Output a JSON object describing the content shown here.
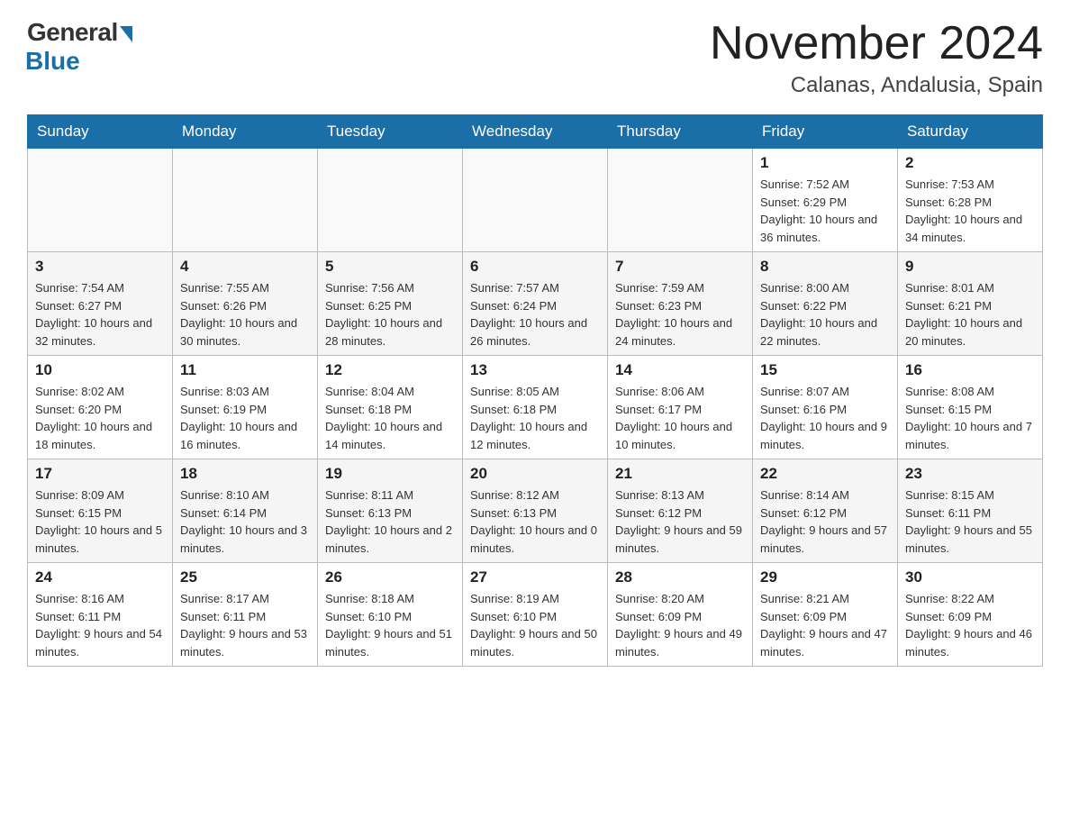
{
  "header": {
    "logo_general": "General",
    "logo_blue": "Blue",
    "month_title": "November 2024",
    "location": "Calanas, Andalusia, Spain"
  },
  "days_of_week": [
    "Sunday",
    "Monday",
    "Tuesday",
    "Wednesday",
    "Thursday",
    "Friday",
    "Saturday"
  ],
  "weeks": [
    [
      {
        "day": "",
        "sunrise": "",
        "sunset": "",
        "daylight": ""
      },
      {
        "day": "",
        "sunrise": "",
        "sunset": "",
        "daylight": ""
      },
      {
        "day": "",
        "sunrise": "",
        "sunset": "",
        "daylight": ""
      },
      {
        "day": "",
        "sunrise": "",
        "sunset": "",
        "daylight": ""
      },
      {
        "day": "",
        "sunrise": "",
        "sunset": "",
        "daylight": ""
      },
      {
        "day": "1",
        "sunrise": "Sunrise: 7:52 AM",
        "sunset": "Sunset: 6:29 PM",
        "daylight": "Daylight: 10 hours and 36 minutes."
      },
      {
        "day": "2",
        "sunrise": "Sunrise: 7:53 AM",
        "sunset": "Sunset: 6:28 PM",
        "daylight": "Daylight: 10 hours and 34 minutes."
      }
    ],
    [
      {
        "day": "3",
        "sunrise": "Sunrise: 7:54 AM",
        "sunset": "Sunset: 6:27 PM",
        "daylight": "Daylight: 10 hours and 32 minutes."
      },
      {
        "day": "4",
        "sunrise": "Sunrise: 7:55 AM",
        "sunset": "Sunset: 6:26 PM",
        "daylight": "Daylight: 10 hours and 30 minutes."
      },
      {
        "day": "5",
        "sunrise": "Sunrise: 7:56 AM",
        "sunset": "Sunset: 6:25 PM",
        "daylight": "Daylight: 10 hours and 28 minutes."
      },
      {
        "day": "6",
        "sunrise": "Sunrise: 7:57 AM",
        "sunset": "Sunset: 6:24 PM",
        "daylight": "Daylight: 10 hours and 26 minutes."
      },
      {
        "day": "7",
        "sunrise": "Sunrise: 7:59 AM",
        "sunset": "Sunset: 6:23 PM",
        "daylight": "Daylight: 10 hours and 24 minutes."
      },
      {
        "day": "8",
        "sunrise": "Sunrise: 8:00 AM",
        "sunset": "Sunset: 6:22 PM",
        "daylight": "Daylight: 10 hours and 22 minutes."
      },
      {
        "day": "9",
        "sunrise": "Sunrise: 8:01 AM",
        "sunset": "Sunset: 6:21 PM",
        "daylight": "Daylight: 10 hours and 20 minutes."
      }
    ],
    [
      {
        "day": "10",
        "sunrise": "Sunrise: 8:02 AM",
        "sunset": "Sunset: 6:20 PM",
        "daylight": "Daylight: 10 hours and 18 minutes."
      },
      {
        "day": "11",
        "sunrise": "Sunrise: 8:03 AM",
        "sunset": "Sunset: 6:19 PM",
        "daylight": "Daylight: 10 hours and 16 minutes."
      },
      {
        "day": "12",
        "sunrise": "Sunrise: 8:04 AM",
        "sunset": "Sunset: 6:18 PM",
        "daylight": "Daylight: 10 hours and 14 minutes."
      },
      {
        "day": "13",
        "sunrise": "Sunrise: 8:05 AM",
        "sunset": "Sunset: 6:18 PM",
        "daylight": "Daylight: 10 hours and 12 minutes."
      },
      {
        "day": "14",
        "sunrise": "Sunrise: 8:06 AM",
        "sunset": "Sunset: 6:17 PM",
        "daylight": "Daylight: 10 hours and 10 minutes."
      },
      {
        "day": "15",
        "sunrise": "Sunrise: 8:07 AM",
        "sunset": "Sunset: 6:16 PM",
        "daylight": "Daylight: 10 hours and 9 minutes."
      },
      {
        "day": "16",
        "sunrise": "Sunrise: 8:08 AM",
        "sunset": "Sunset: 6:15 PM",
        "daylight": "Daylight: 10 hours and 7 minutes."
      }
    ],
    [
      {
        "day": "17",
        "sunrise": "Sunrise: 8:09 AM",
        "sunset": "Sunset: 6:15 PM",
        "daylight": "Daylight: 10 hours and 5 minutes."
      },
      {
        "day": "18",
        "sunrise": "Sunrise: 8:10 AM",
        "sunset": "Sunset: 6:14 PM",
        "daylight": "Daylight: 10 hours and 3 minutes."
      },
      {
        "day": "19",
        "sunrise": "Sunrise: 8:11 AM",
        "sunset": "Sunset: 6:13 PM",
        "daylight": "Daylight: 10 hours and 2 minutes."
      },
      {
        "day": "20",
        "sunrise": "Sunrise: 8:12 AM",
        "sunset": "Sunset: 6:13 PM",
        "daylight": "Daylight: 10 hours and 0 minutes."
      },
      {
        "day": "21",
        "sunrise": "Sunrise: 8:13 AM",
        "sunset": "Sunset: 6:12 PM",
        "daylight": "Daylight: 9 hours and 59 minutes."
      },
      {
        "day": "22",
        "sunrise": "Sunrise: 8:14 AM",
        "sunset": "Sunset: 6:12 PM",
        "daylight": "Daylight: 9 hours and 57 minutes."
      },
      {
        "day": "23",
        "sunrise": "Sunrise: 8:15 AM",
        "sunset": "Sunset: 6:11 PM",
        "daylight": "Daylight: 9 hours and 55 minutes."
      }
    ],
    [
      {
        "day": "24",
        "sunrise": "Sunrise: 8:16 AM",
        "sunset": "Sunset: 6:11 PM",
        "daylight": "Daylight: 9 hours and 54 minutes."
      },
      {
        "day": "25",
        "sunrise": "Sunrise: 8:17 AM",
        "sunset": "Sunset: 6:11 PM",
        "daylight": "Daylight: 9 hours and 53 minutes."
      },
      {
        "day": "26",
        "sunrise": "Sunrise: 8:18 AM",
        "sunset": "Sunset: 6:10 PM",
        "daylight": "Daylight: 9 hours and 51 minutes."
      },
      {
        "day": "27",
        "sunrise": "Sunrise: 8:19 AM",
        "sunset": "Sunset: 6:10 PM",
        "daylight": "Daylight: 9 hours and 50 minutes."
      },
      {
        "day": "28",
        "sunrise": "Sunrise: 8:20 AM",
        "sunset": "Sunset: 6:09 PM",
        "daylight": "Daylight: 9 hours and 49 minutes."
      },
      {
        "day": "29",
        "sunrise": "Sunrise: 8:21 AM",
        "sunset": "Sunset: 6:09 PM",
        "daylight": "Daylight: 9 hours and 47 minutes."
      },
      {
        "day": "30",
        "sunrise": "Sunrise: 8:22 AM",
        "sunset": "Sunset: 6:09 PM",
        "daylight": "Daylight: 9 hours and 46 minutes."
      }
    ]
  ]
}
